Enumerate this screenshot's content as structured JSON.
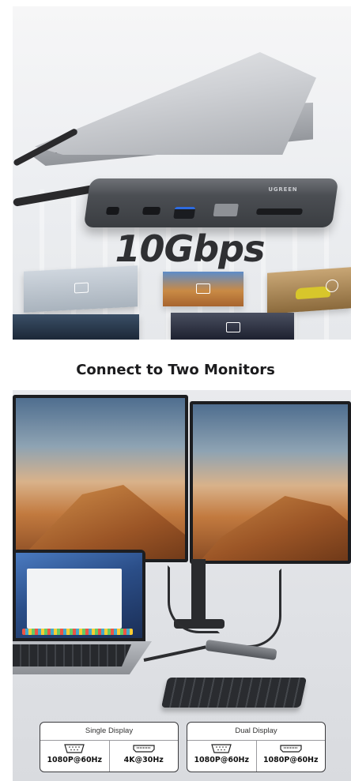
{
  "banner": {
    "hub_brand": "UGREEN",
    "speed_label": "10Gbps"
  },
  "section_title": "Connect to Two Monitors",
  "specs": [
    {
      "heading": "Single Display",
      "items": [
        {
          "icon": "vga-port-icon",
          "resolution": "1080P@60Hz"
        },
        {
          "icon": "hdmi-port-icon",
          "resolution": "4K@30Hz"
        }
      ]
    },
    {
      "heading": "Dual Display",
      "items": [
        {
          "icon": "vga-port-icon",
          "resolution": "1080P@60Hz"
        },
        {
          "icon": "hdmi-port-icon",
          "resolution": "1080P@60Hz"
        }
      ]
    }
  ],
  "colors": {
    "heading_text": "#1c1c1e",
    "hub_body": "#4b4e53",
    "border": "#3a3a3d"
  }
}
